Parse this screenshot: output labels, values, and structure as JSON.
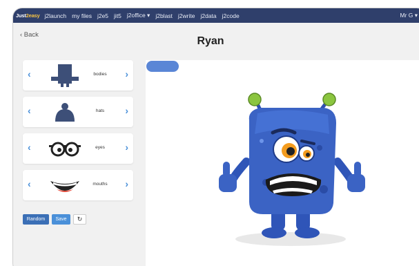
{
  "navbar": {
    "brand_main": "Just",
    "brand_accent": "2easy",
    "items": [
      "j2launch",
      "my files",
      "j2e5",
      "jit5",
      "j2office ▾",
      "j2blast",
      "j2write",
      "j2data",
      "j2code"
    ],
    "user": "Mr G ▾"
  },
  "back_label": "‹ Back",
  "title": "Ryan",
  "parts": [
    {
      "label": "bodies",
      "icon": "body-silhouette-icon"
    },
    {
      "label": "hats",
      "icon": "hat-icon"
    },
    {
      "label": "eyes",
      "icon": "eyes-icon"
    },
    {
      "label": "mouths",
      "icon": "mouth-icon"
    }
  ],
  "buttons": {
    "random": "Random",
    "save": "Save",
    "refresh": "↻"
  },
  "colors": {
    "navbar": "#2f3f6b",
    "accent": "#4a90d9",
    "monster_body": "#3b63c4",
    "antenna": "#8bc53f"
  }
}
